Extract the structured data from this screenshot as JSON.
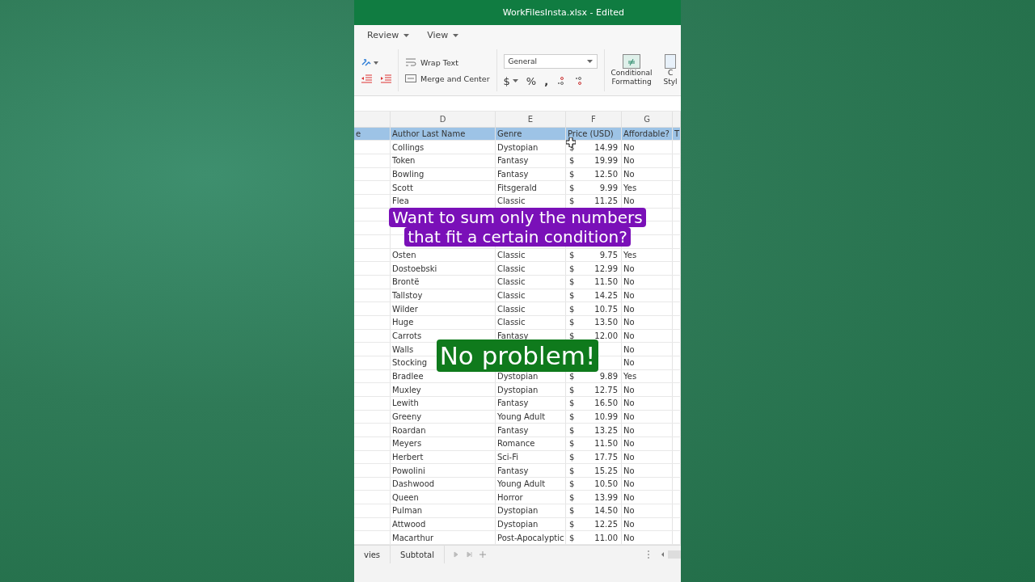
{
  "window": {
    "title": "WorkFilesInsta.xlsx - Edited"
  },
  "menu": [
    {
      "label": "Review"
    },
    {
      "label": "View"
    }
  ],
  "ribbon": {
    "wrap_text": "Wrap Text",
    "merge": "Merge and Center",
    "number_format": "General",
    "currency": "$",
    "percent": "%",
    "comma": ",",
    "conditional": [
      "Conditional",
      "Formatting"
    ],
    "cell_styles": [
      "C",
      "Styl"
    ]
  },
  "sheet": {
    "columns": [
      "D",
      "E",
      "F",
      "G"
    ],
    "header": [
      "e",
      "Author Last Name",
      "Genre",
      "Price (USD)",
      "Affordable?",
      "T"
    ],
    "rows": [
      {
        "author": "Collings",
        "genre": "Dystopian",
        "currency": "$",
        "price": "14.99",
        "affordable": "No"
      },
      {
        "author": "Token",
        "genre": "Fantasy",
        "currency": "$",
        "price": "19.99",
        "affordable": "No"
      },
      {
        "author": "Bowling",
        "genre": "Fantasy",
        "currency": "$",
        "price": "12.50",
        "affordable": "No"
      },
      {
        "author": "Scott",
        "genre": "Fitsgerald",
        "currency": "$",
        "price": "9.99",
        "affordable": "Yes"
      },
      {
        "author": "Flea",
        "genre": "Classic",
        "currency": "$",
        "price": "11.25",
        "affordable": "No"
      },
      {},
      {},
      {},
      {
        "author": "Osten",
        "genre": "Classic",
        "currency": "$",
        "price": "9.75",
        "affordable": "Yes"
      },
      {
        "author": "Dostoebski",
        "genre": "Classic",
        "currency": "$",
        "price": "12.99",
        "affordable": "No"
      },
      {
        "author": "Brontë",
        "genre": "Classic",
        "currency": "$",
        "price": "11.50",
        "affordable": "No"
      },
      {
        "author": "Tallstoy",
        "genre": "Classic",
        "currency": "$",
        "price": "14.25",
        "affordable": "No"
      },
      {
        "author": "Wilder",
        "genre": "Classic",
        "currency": "$",
        "price": "10.75",
        "affordable": "No"
      },
      {
        "author": "Huge",
        "genre": "Classic",
        "currency": "$",
        "price": "13.50",
        "affordable": "No"
      },
      {
        "author": "Carrots",
        "genre": "Fantasy",
        "currency": "$",
        "price": "12.00",
        "affordable": "No"
      },
      {
        "author": "Walls",
        "affordable": "No"
      },
      {
        "author": "Stocking",
        "affordable": "No"
      },
      {
        "author": "Bradlee",
        "genre": "Dystopian",
        "currency": "$",
        "price": "9.89",
        "affordable": "Yes"
      },
      {
        "author": "Muxley",
        "genre": "Dystopian",
        "currency": "$",
        "price": "12.75",
        "affordable": "No"
      },
      {
        "author": "Lewith",
        "genre": "Fantasy",
        "currency": "$",
        "price": "16.50",
        "affordable": "No"
      },
      {
        "author": "Greeny",
        "genre": "Young Adult",
        "currency": "$",
        "price": "10.99",
        "affordable": "No"
      },
      {
        "author": "Roardan",
        "genre": "Fantasy",
        "currency": "$",
        "price": "13.25",
        "affordable": "No"
      },
      {
        "author": "Meyers",
        "genre": "Romance",
        "currency": "$",
        "price": "11.50",
        "affordable": "No"
      },
      {
        "author": "Herbert",
        "genre": "Sci-Fi",
        "currency": "$",
        "price": "17.75",
        "affordable": "No"
      },
      {
        "author": "Powolini",
        "genre": "Fantasy",
        "currency": "$",
        "price": "15.25",
        "affordable": "No"
      },
      {
        "author": "Dashwood",
        "genre": "Young Adult",
        "currency": "$",
        "price": "10.50",
        "affordable": "No"
      },
      {
        "author": "Queen",
        "genre": "Horror",
        "currency": "$",
        "price": "13.99",
        "affordable": "No"
      },
      {
        "author": "Pulman",
        "genre": "Dystopian",
        "currency": "$",
        "price": "14.50",
        "affordable": "No"
      },
      {
        "author": "Attwood",
        "genre": "Dystopian",
        "currency": "$",
        "price": "12.25",
        "affordable": "No"
      },
      {
        "author": "Macarthur",
        "genre": "Post-Apocalyptic",
        "currency": "$",
        "price": "11.00",
        "affordable": "No"
      }
    ]
  },
  "sheet_tabs": [
    {
      "label": "vies"
    },
    {
      "label": "Subtotal"
    }
  ],
  "captions": [
    {
      "lines": [
        "Want to sum only the numbers",
        "that fit a certain condition?"
      ],
      "color": "#7a10b8"
    },
    {
      "lines": [
        "No problem!"
      ],
      "color": "#0f7a1c"
    }
  ]
}
